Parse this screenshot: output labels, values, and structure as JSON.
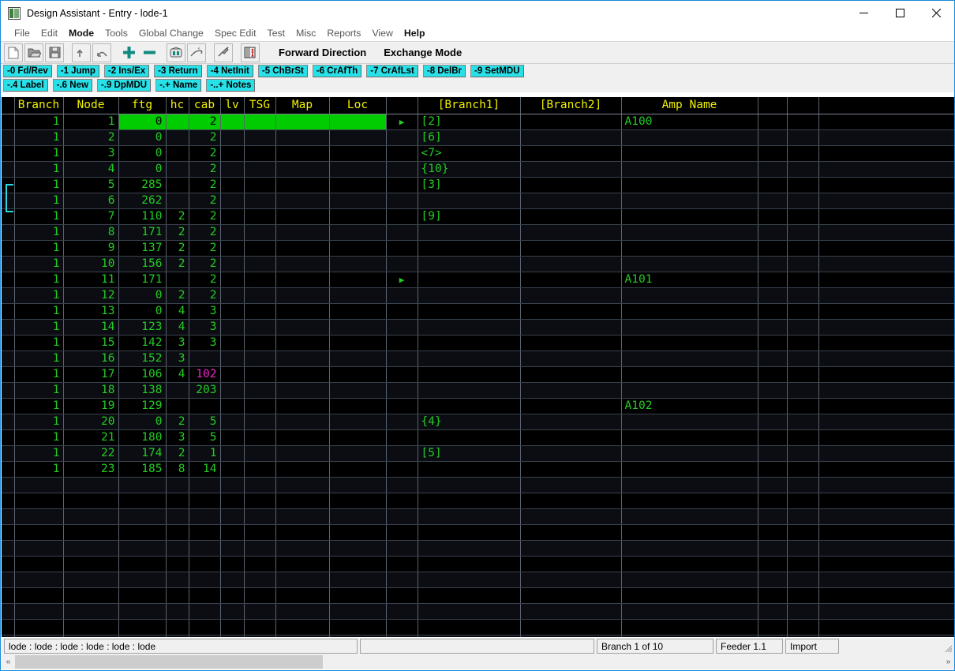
{
  "window": {
    "title": "Design Assistant - Entry - lode-1",
    "icon": "app-icon",
    "minimize": "–",
    "maximize": "□",
    "close": "✕"
  },
  "menubar": {
    "items": [
      {
        "label": "File",
        "strong": false
      },
      {
        "label": "Edit",
        "strong": false
      },
      {
        "label": "Mode",
        "strong": true
      },
      {
        "label": "Tools",
        "strong": false
      },
      {
        "label": "Global Change",
        "strong": false
      },
      {
        "label": "Spec Edit",
        "strong": false
      },
      {
        "label": "Test",
        "strong": false
      },
      {
        "label": "Misc",
        "strong": false
      },
      {
        "label": "Reports",
        "strong": false
      },
      {
        "label": "View",
        "strong": false
      },
      {
        "label": "Help",
        "strong": true
      }
    ]
  },
  "toolbar": {
    "icons": [
      "new-file-icon",
      "open-folder-icon",
      "save-disk-icon",
      "undo-arrow-icon",
      "redo-arrow-icon",
      "add-plus-icon",
      "remove-minus-icon",
      "tv-monitor-icon",
      "curve-path-icon",
      "plug-connector-icon",
      "book-person-icon"
    ],
    "direction_label": "Forward Direction",
    "mode_label": "Exchange Mode"
  },
  "function_keys": {
    "row1": [
      "-0 Fd/Rev",
      "-1 Jump",
      "-2 Ins/Ex",
      "-3 Return",
      "-4 NetInit",
      "-5 ChBrSt",
      "-6 CrAfTh",
      "-7 CrAfLst",
      "-8 DelBr",
      "-9 SetMDU"
    ],
    "row2": [
      "-.4 Label",
      "-.6 New",
      "-.9 DpMDU",
      "-.+ Name",
      "-..+ Notes"
    ]
  },
  "grid": {
    "columns": [
      {
        "key": "mark",
        "label": ""
      },
      {
        "key": "branch",
        "label": "Branch"
      },
      {
        "key": "node",
        "label": "Node"
      },
      {
        "key": "ftg",
        "label": "ftg"
      },
      {
        "key": "hc",
        "label": "hc"
      },
      {
        "key": "cab",
        "label": "cab"
      },
      {
        "key": "lv",
        "label": "lv"
      },
      {
        "key": "tsg",
        "label": "TSG"
      },
      {
        "key": "map",
        "label": "Map"
      },
      {
        "key": "loc",
        "label": "Loc"
      },
      {
        "key": "sel",
        "label": ""
      },
      {
        "key": "branch1",
        "label": "[Branch1]"
      },
      {
        "key": "branch2",
        "label": "[Branch2]"
      },
      {
        "key": "amp",
        "label": "Amp Name"
      },
      {
        "key": "x1",
        "label": ""
      },
      {
        "key": "x2",
        "label": ""
      },
      {
        "key": "x3",
        "label": ""
      }
    ],
    "rows": [
      {
        "branch": "1",
        "node": "1",
        "ftg": "0",
        "hc": "",
        "cab": "2",
        "lv": "",
        "tsg": "",
        "map": "",
        "loc": "",
        "sel": "▶",
        "branch1": "[2]",
        "branch2": "",
        "amp": "A100",
        "highlight": true
      },
      {
        "branch": "1",
        "node": "2",
        "ftg": "0",
        "hc": "",
        "cab": "2",
        "lv": "",
        "tsg": "",
        "map": "",
        "loc": "",
        "sel": "",
        "branch1": "[6]",
        "branch2": "",
        "amp": ""
      },
      {
        "branch": "1",
        "node": "3",
        "ftg": "0",
        "hc": "",
        "cab": "2",
        "lv": "",
        "tsg": "",
        "map": "",
        "loc": "",
        "sel": "",
        "branch1": "<7>",
        "branch2": "",
        "amp": ""
      },
      {
        "branch": "1",
        "node": "4",
        "ftg": "0",
        "hc": "",
        "cab": "2",
        "lv": "",
        "tsg": "",
        "map": "",
        "loc": "",
        "sel": "",
        "branch1": "{10}",
        "branch2": "",
        "amp": ""
      },
      {
        "branch": "1",
        "node": "5",
        "ftg": "285",
        "hc": "",
        "cab": "2",
        "lv": "",
        "tsg": "",
        "map": "",
        "loc": "",
        "sel": "",
        "branch1": "[3]",
        "branch2": "",
        "amp": ""
      },
      {
        "branch": "1",
        "node": "6",
        "ftg": "262",
        "hc": "",
        "cab": "2",
        "lv": "",
        "tsg": "",
        "map": "",
        "loc": "",
        "sel": "",
        "branch1": "",
        "branch2": "",
        "amp": ""
      },
      {
        "branch": "1",
        "node": "7",
        "ftg": "110",
        "hc": "2",
        "cab": "2",
        "lv": "",
        "tsg": "",
        "map": "",
        "loc": "",
        "sel": "",
        "branch1": "[9]",
        "branch2": "",
        "amp": ""
      },
      {
        "branch": "1",
        "node": "8",
        "ftg": "171",
        "hc": "2",
        "cab": "2",
        "lv": "",
        "tsg": "",
        "map": "",
        "loc": "",
        "sel": "",
        "branch1": "",
        "branch2": "",
        "amp": ""
      },
      {
        "branch": "1",
        "node": "9",
        "ftg": "137",
        "hc": "2",
        "cab": "2",
        "lv": "",
        "tsg": "",
        "map": "",
        "loc": "",
        "sel": "",
        "branch1": "",
        "branch2": "",
        "amp": ""
      },
      {
        "branch": "1",
        "node": "10",
        "ftg": "156",
        "hc": "2",
        "cab": "2",
        "lv": "",
        "tsg": "",
        "map": "",
        "loc": "",
        "sel": "",
        "branch1": "",
        "branch2": "",
        "amp": ""
      },
      {
        "branch": "1",
        "node": "11",
        "ftg": "171",
        "hc": "",
        "cab": "2",
        "lv": "",
        "tsg": "",
        "map": "",
        "loc": "",
        "sel": "▶",
        "branch1": "",
        "branch2": "",
        "amp": "A101"
      },
      {
        "branch": "1",
        "node": "12",
        "ftg": "0",
        "hc": "2",
        "cab": "2",
        "lv": "",
        "tsg": "",
        "map": "",
        "loc": "",
        "sel": "",
        "branch1": "",
        "branch2": "",
        "amp": ""
      },
      {
        "branch": "1",
        "node": "13",
        "ftg": "0",
        "hc": "4",
        "cab": "3",
        "lv": "",
        "tsg": "",
        "map": "",
        "loc": "",
        "sel": "",
        "branch1": "",
        "branch2": "",
        "amp": ""
      },
      {
        "branch": "1",
        "node": "14",
        "ftg": "123",
        "hc": "4",
        "cab": "3",
        "lv": "",
        "tsg": "",
        "map": "",
        "loc": "",
        "sel": "",
        "branch1": "",
        "branch2": "",
        "amp": ""
      },
      {
        "branch": "1",
        "node": "15",
        "ftg": "142",
        "hc": "3",
        "cab": "3",
        "lv": "",
        "tsg": "",
        "map": "",
        "loc": "",
        "sel": "",
        "branch1": "",
        "branch2": "",
        "amp": ""
      },
      {
        "branch": "1",
        "node": "16",
        "ftg": "152",
        "hc": "3",
        "cab": "",
        "lv": "",
        "tsg": "",
        "map": "",
        "loc": "",
        "sel": "",
        "branch1": "",
        "branch2": "",
        "amp": ""
      },
      {
        "branch": "1",
        "node": "17",
        "ftg": "106",
        "hc": "4",
        "cab": "102",
        "cab_color": "magenta",
        "lv": "",
        "tsg": "",
        "map": "",
        "loc": "",
        "sel": "",
        "branch1": "",
        "branch2": "",
        "amp": ""
      },
      {
        "branch": "1",
        "node": "18",
        "ftg": "138",
        "hc": "",
        "cab": "203",
        "lv": "",
        "tsg": "",
        "map": "",
        "loc": "",
        "sel": "",
        "branch1": "",
        "branch2": "",
        "amp": ""
      },
      {
        "branch": "1",
        "node": "19",
        "ftg": "129",
        "hc": "",
        "cab": "",
        "lv": "",
        "tsg": "",
        "map": "",
        "loc": "",
        "sel": "",
        "branch1": "",
        "branch2": "",
        "amp": "A102"
      },
      {
        "branch": "1",
        "node": "20",
        "ftg": "0",
        "hc": "2",
        "cab": "5",
        "lv": "",
        "tsg": "",
        "map": "",
        "loc": "",
        "sel": "",
        "branch1": "{4}",
        "branch2": "",
        "amp": ""
      },
      {
        "branch": "1",
        "node": "21",
        "ftg": "180",
        "hc": "3",
        "cab": "5",
        "lv": "",
        "tsg": "",
        "map": "",
        "loc": "",
        "sel": "",
        "branch1": "",
        "branch2": "",
        "amp": ""
      },
      {
        "branch": "1",
        "node": "22",
        "ftg": "174",
        "hc": "2",
        "cab": "1",
        "lv": "",
        "tsg": "",
        "map": "",
        "loc": "",
        "sel": "",
        "branch1": "[5]",
        "branch2": "",
        "amp": ""
      },
      {
        "branch": "1",
        "node": "23",
        "ftg": "185",
        "hc": "8",
        "cab": "14",
        "lv": "",
        "tsg": "",
        "map": "",
        "loc": "",
        "sel": "",
        "branch1": "",
        "branch2": "",
        "amp": ""
      }
    ],
    "empty_row_count": 12,
    "bracket_marker": "group-bracket-rows-5-6"
  },
  "statusbar": {
    "path": "lode : lode : lode : lode : lode : lode",
    "field2": "",
    "branch": "Branch 1 of 10",
    "feeder": "Feeder 1.1",
    "mode": "Import"
  },
  "scrollbar": {
    "left_arrow": "«",
    "right_arrow": "»"
  },
  "colors": {
    "fkey_bg": "#28e0e8",
    "grid_bg": "#000000",
    "grid_text": "#22cc22",
    "header_text": "#f0f000",
    "highlight": "#00cc00",
    "magenta": "#ee22cc",
    "bracket": "#26d6e0",
    "window_border": "#1a8cd8"
  }
}
